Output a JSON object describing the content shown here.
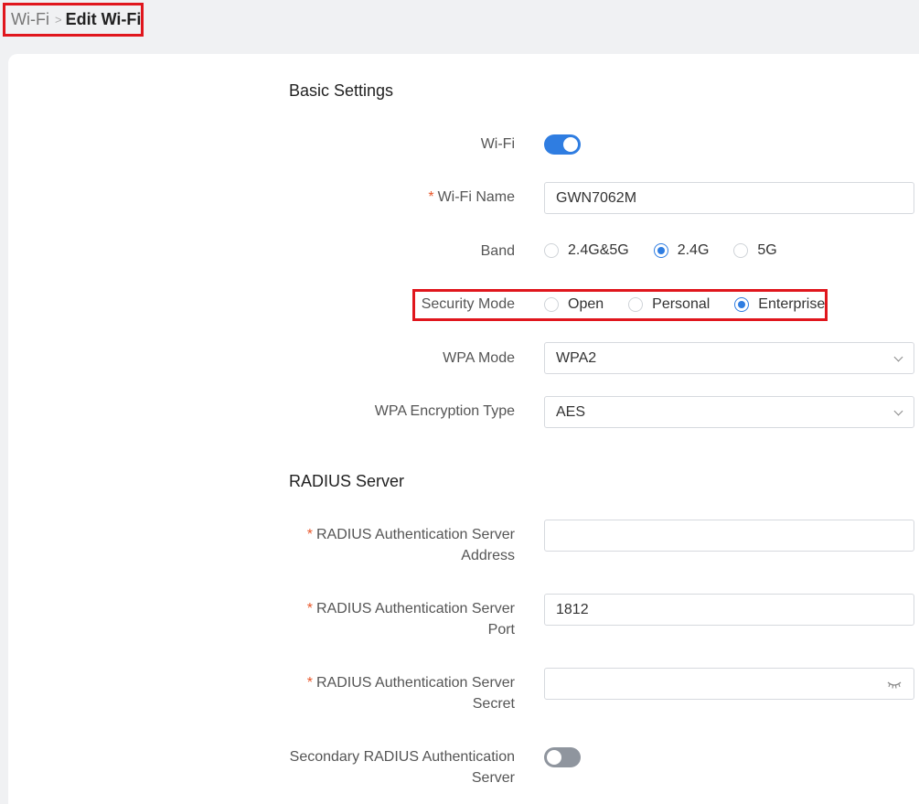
{
  "breadcrumb": {
    "parent": "Wi-Fi",
    "separator": ">",
    "current": "Edit Wi-Fi"
  },
  "basic": {
    "title": "Basic Settings",
    "wifi_label": "Wi-Fi",
    "wifi_enabled": true,
    "name_label": "Wi-Fi Name",
    "name_value": "GWN7062M",
    "band_label": "Band",
    "band_options": [
      "2.4G&5G",
      "2.4G",
      "5G"
    ],
    "band_selected": "2.4G",
    "security_label": "Security Mode",
    "security_options": [
      "Open",
      "Personal",
      "Enterprise"
    ],
    "security_selected": "Enterprise",
    "wpa_mode_label": "WPA Mode",
    "wpa_mode_value": "WPA2",
    "wpa_enc_label": "WPA Encryption Type",
    "wpa_enc_value": "AES"
  },
  "radius": {
    "title": "RADIUS Server",
    "auth_addr_label_1": "RADIUS Authentication Server",
    "auth_addr_label_2": "Address",
    "auth_addr_value": "",
    "auth_port_label_1": "RADIUS Authentication Server",
    "auth_port_label_2": "Port",
    "auth_port_value": "1812",
    "auth_secret_label_1": "RADIUS Authentication Server",
    "auth_secret_label_2": "Secret",
    "auth_secret_value": "",
    "secondary_label_1": "Secondary RADIUS Authentication",
    "secondary_label_2": "Server",
    "secondary_enabled": false
  },
  "colors": {
    "accent": "#2f7de1",
    "highlight": "#e0161d",
    "required": "#e8572a"
  }
}
